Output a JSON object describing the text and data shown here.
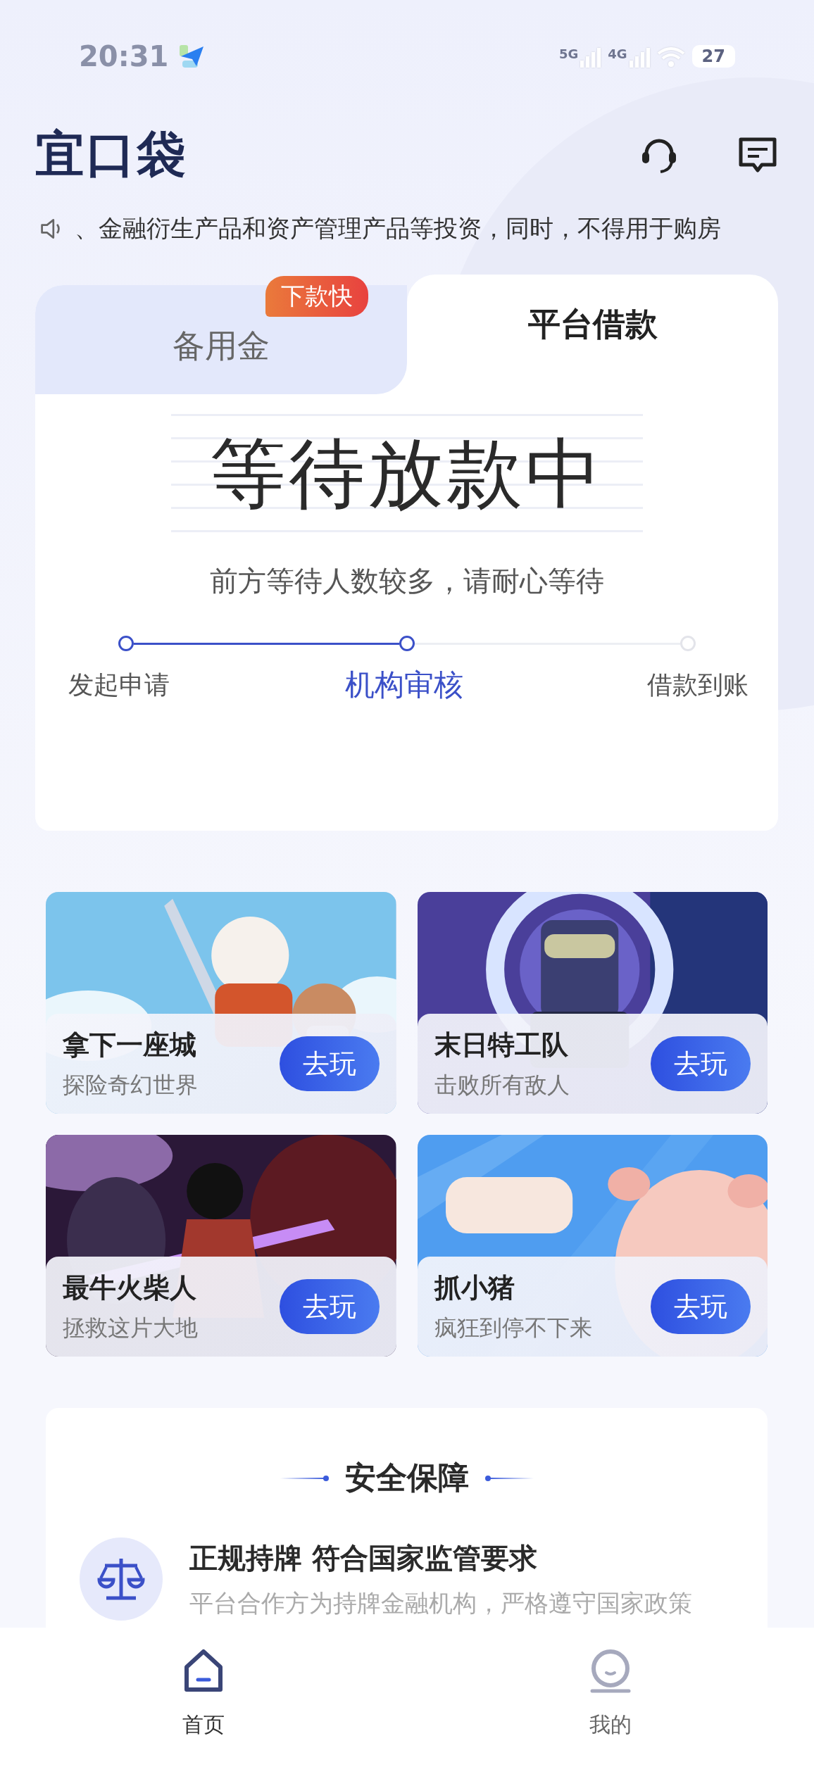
{
  "status_bar": {
    "time": "20:31",
    "network_1": "5G",
    "network_2": "4G",
    "battery": "27"
  },
  "header": {
    "logo": "宜口袋"
  },
  "notice": {
    "text": "、金融衍生产品和资产管理产品等投资，同时，不得用于购房"
  },
  "tabs": [
    {
      "label": "备用金",
      "selected": false,
      "badge": "下款快"
    },
    {
      "label": "平台借款",
      "selected": true
    }
  ],
  "status": {
    "title": "等待放款中",
    "subtitle": "前方等待人数较多，请耐心等待"
  },
  "steps": [
    {
      "label": "发起申请",
      "reached": true,
      "selected": false
    },
    {
      "label": "机构审核",
      "reached": true,
      "selected": true
    },
    {
      "label": "借款到账",
      "reached": false,
      "selected": false
    }
  ],
  "games": [
    {
      "kind": "picture",
      "title": "拿下一座城",
      "subtitle": "探险奇幻世界",
      "button": "去玩"
    },
    {
      "kind": "picture",
      "title": "末日特工队",
      "subtitle": "击败所有敌人",
      "button": "去玩"
    },
    {
      "kind": "picture",
      "title": "最牛火柴人",
      "subtitle": "拯救这片大地",
      "button": "去玩"
    },
    {
      "kind": "picture",
      "title": "抓小猪",
      "subtitle": "疯狂到停不下来",
      "button": "去玩"
    }
  ],
  "security": {
    "title": "安全保障",
    "items": [
      {
        "title": "正规持牌 符合国家监管要求",
        "description": "平台合作方为持牌金融机构，严格遵守国家政策"
      }
    ]
  },
  "bottom_nav": [
    {
      "label": "首页",
      "selected": true
    },
    {
      "label": "我的",
      "selected": false
    }
  ]
}
